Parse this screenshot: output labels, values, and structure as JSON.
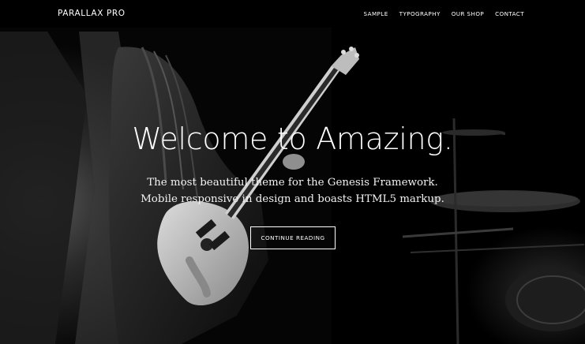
{
  "header": {
    "site_title": "PARALLAX PRO",
    "nav": [
      "SAMPLE",
      "TYPOGRAPHY",
      "OUR SHOP",
      "CONTACT"
    ]
  },
  "hero": {
    "title": "Welcome to Amazing.",
    "subtitle_line1": "The most beautiful theme for the Genesis Framework.",
    "subtitle_line2": "Mobile responsive in design and boasts HTML5 markup.",
    "button_label": "CONTINUE READING"
  },
  "colors": {
    "background": "#000000",
    "text": "#ffffff"
  }
}
